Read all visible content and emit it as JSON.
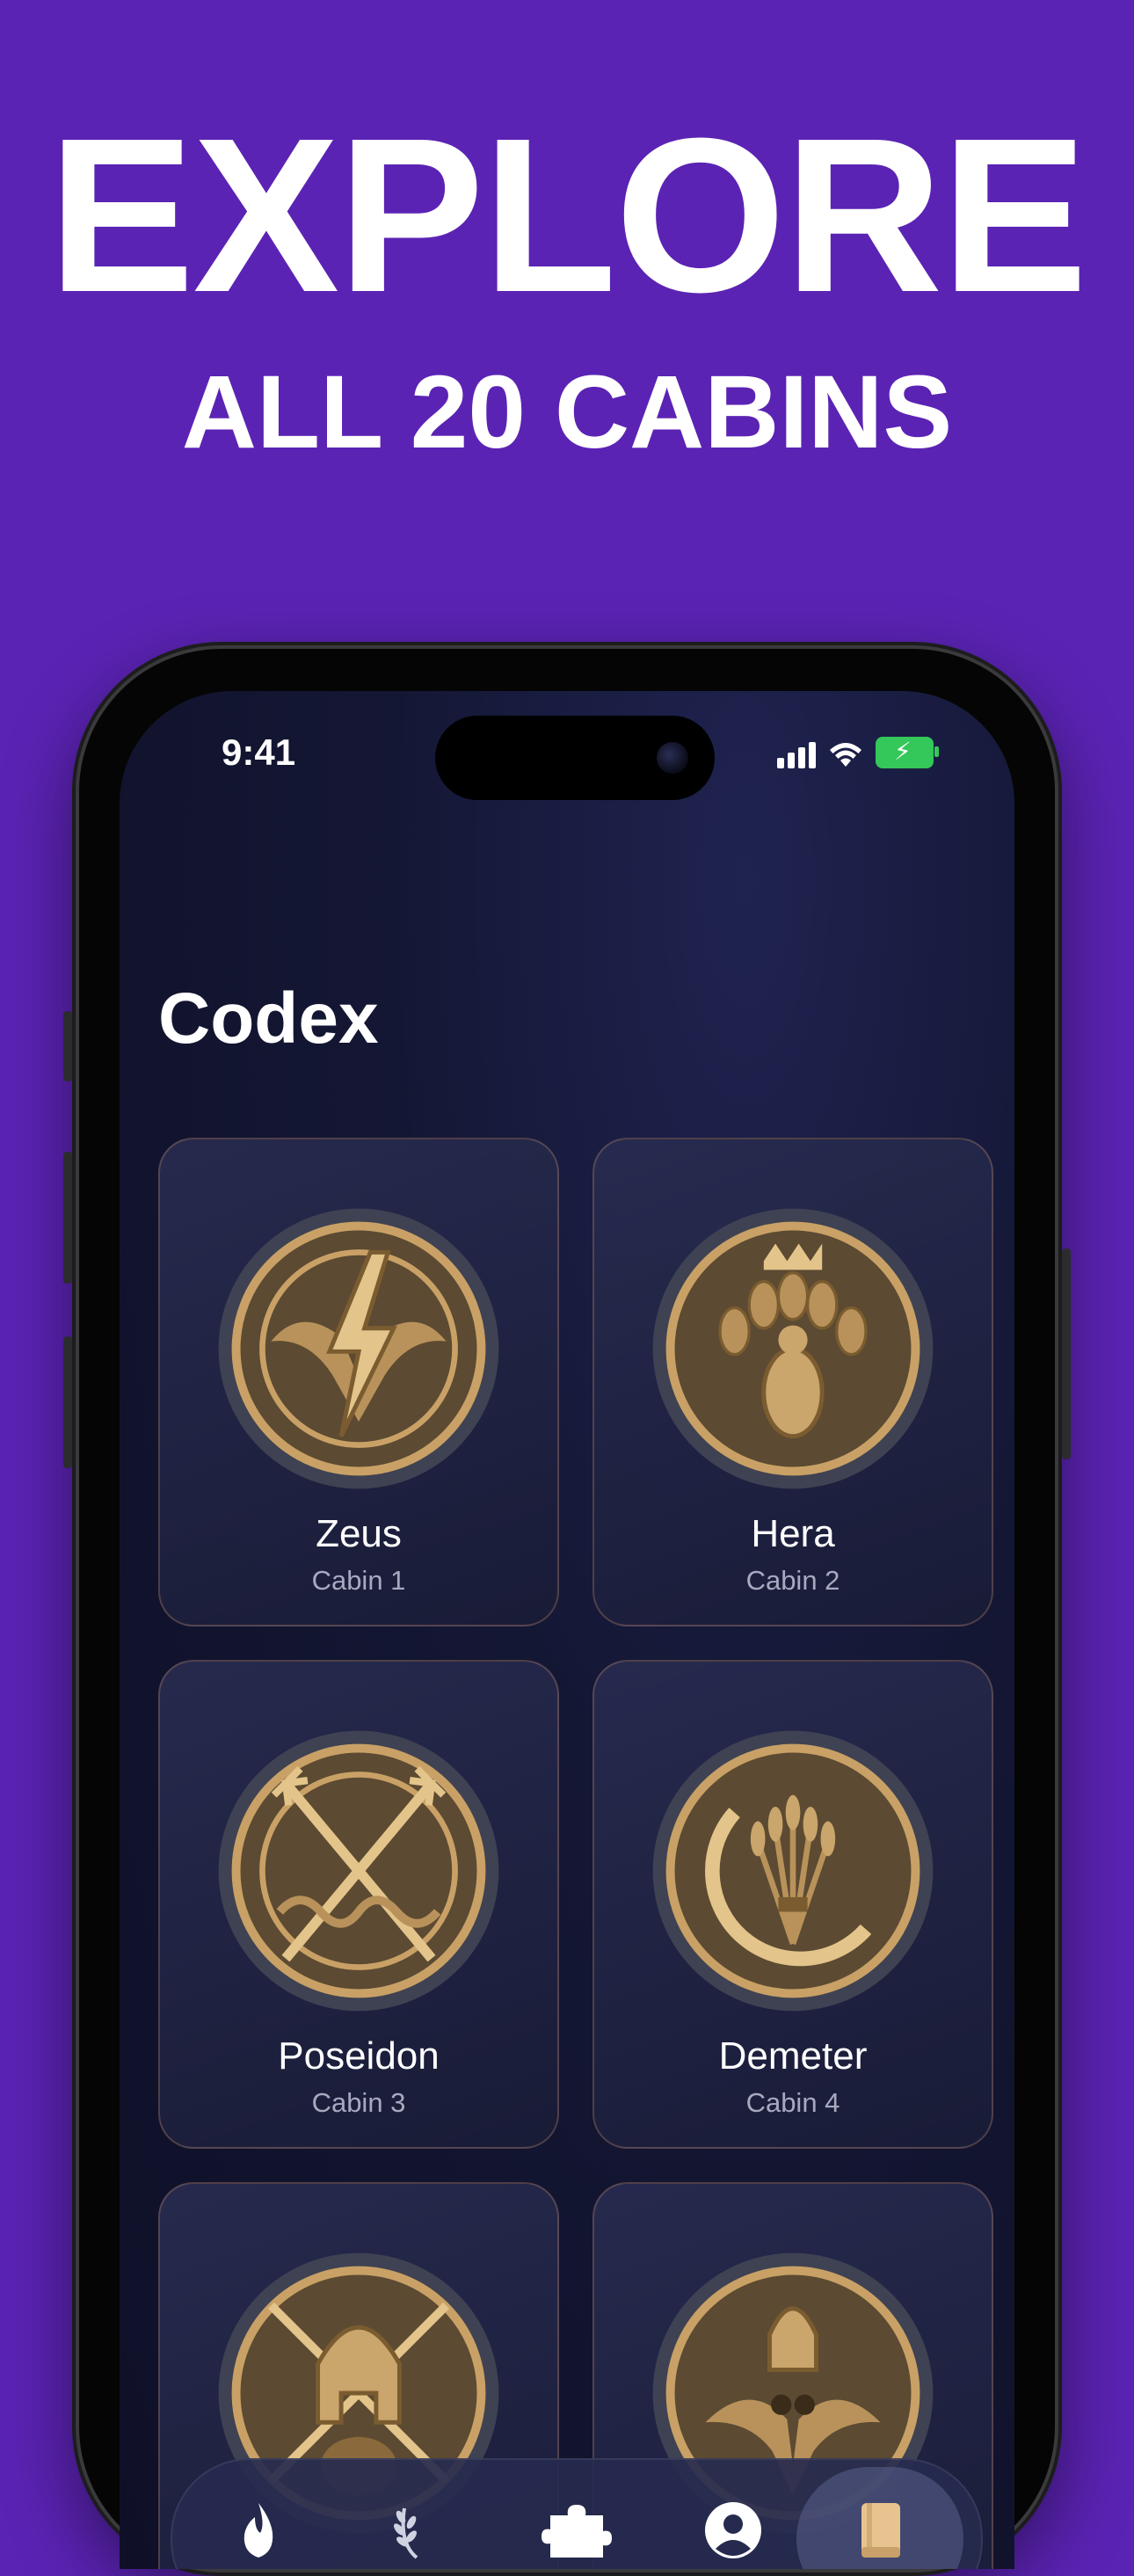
{
  "hero": {
    "line1": "EXPLORE",
    "line2": "ALL 20 CABINS"
  },
  "status_bar": {
    "time": "9:41"
  },
  "page": {
    "title": "Codex"
  },
  "cabins": [
    {
      "name": "Zeus",
      "cabin": "Cabin 1",
      "emblem": "lightning-eagle-icon"
    },
    {
      "name": "Hera",
      "cabin": "Cabin 2",
      "emblem": "peacock-crown-icon"
    },
    {
      "name": "Poseidon",
      "cabin": "Cabin 3",
      "emblem": "trident-icon"
    },
    {
      "name": "Demeter",
      "cabin": "Cabin 4",
      "emblem": "wheat-sickle-icon"
    },
    {
      "emblem": "spartan-helmet-boar-icon"
    },
    {
      "emblem": "owl-helmet-icon"
    }
  ],
  "tab_bar": {
    "tabs": [
      "flame-icon",
      "laurel-icon",
      "puzzle-icon",
      "profile-icon",
      "book-icon"
    ],
    "active": "book-icon"
  },
  "colors": {
    "background": "#5b23b4",
    "screen": "#141734",
    "card_border": "#b48264",
    "emblem_bronze": "#b8925a",
    "emblem_stone": "#4a4c5c"
  }
}
